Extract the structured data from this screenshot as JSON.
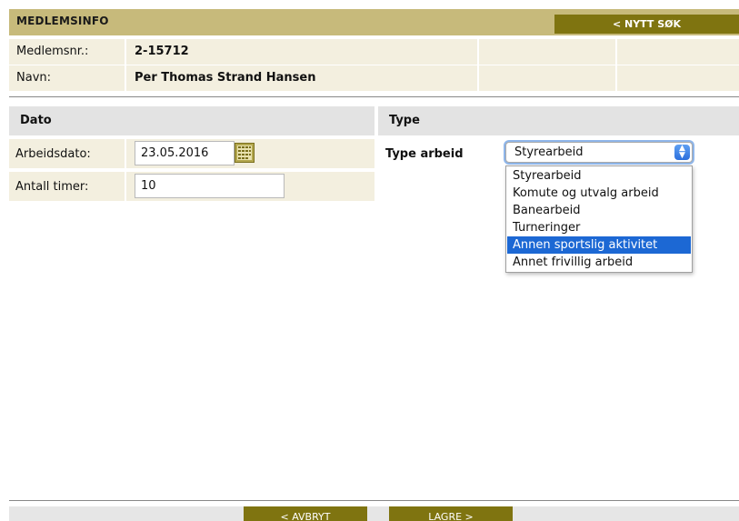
{
  "header": {
    "title": "MEDLEMSINFO",
    "new_search_label": "< NYTT SØK"
  },
  "member": {
    "number_label": "Medlemsnr.:",
    "number_value": "2-15712",
    "name_label": "Navn:",
    "name_value": "Per Thomas Strand Hansen"
  },
  "sections": {
    "date_header": "Dato",
    "type_header": "Type"
  },
  "form": {
    "work_date_label": "Arbeidsdato:",
    "work_date_value": "23.05.2016",
    "hours_label": "Antall timer:",
    "hours_value": "10",
    "type_label": "Type arbeid",
    "type_selected": "Styrearbeid",
    "type_options": [
      "Styrearbeid",
      "Komute og utvalg arbeid",
      "Banearbeid",
      "Turneringer",
      "Annen sportslig aktivitet",
      "Annet frivillig arbeid"
    ],
    "highlighted_option": "Annen sportslig aktivitet"
  },
  "footer": {
    "cancel_label": "< AVBRYT",
    "save_label": "LAGRE >"
  },
  "colors": {
    "header_bg": "#c7ba7b",
    "button_bg": "#7f7410",
    "row_bg": "#f3efdf",
    "section_bg": "#e3e3e3",
    "highlight": "#1c68d4"
  }
}
